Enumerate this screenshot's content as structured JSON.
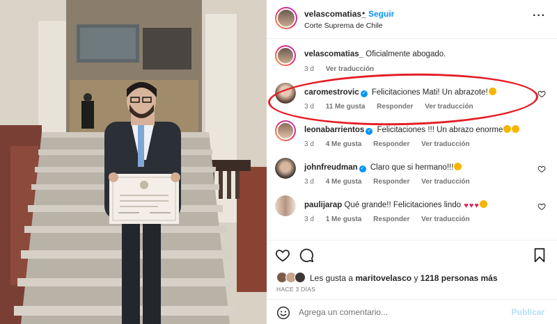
{
  "post": {
    "username": "velascomatias_",
    "separator": "•",
    "follow_label": "Seguir",
    "location": "Corte Suprema de Chile",
    "more_label": "···"
  },
  "comments": [
    {
      "username": "velascomatias_",
      "text": "Oficialmente abogado.",
      "time": "3 d",
      "likes": "",
      "reply": "",
      "translate": "Ver traducción",
      "verified": false
    },
    {
      "username": "caromestrovic",
      "text": "Felicitaciones Mati! Un abrazote!",
      "time": "3 d",
      "likes": "11 Me gusta",
      "reply": "Responder",
      "translate": "Ver traducción",
      "verified": true
    },
    {
      "username": "leonabarrientos",
      "text": "Felicitaciones !!! Un abrazo enorme",
      "time": "3 d",
      "likes": "4 Me gusta",
      "reply": "Responder",
      "translate": "Ver traducción",
      "verified": true
    },
    {
      "username": "johnfreudman",
      "text": "Claro que si hermano!!!",
      "time": "3 d",
      "likes": "4 Me gusta",
      "reply": "Responder",
      "translate": "Ver traducción",
      "verified": true
    },
    {
      "username": "paulijarap",
      "text": "Qué grande!! Felicitaciones lindo",
      "time": "3 d",
      "likes": "1 Me gusta",
      "reply": "Responder",
      "translate": "Ver traducción",
      "verified": true
    }
  ],
  "likes": {
    "prefix": "Les gusta a ",
    "user": "maritovelasco",
    "middle": " y ",
    "count": "1218 personas más"
  },
  "date_label": "HACE 3 DÍAS",
  "add_comment": {
    "placeholder": "Agrega un comentario...",
    "publish_label": "Publicar"
  },
  "colors": {
    "accent": "#0095f6",
    "highlight": "#e41e26",
    "muted": "#737373"
  },
  "icons": [
    "more-icon",
    "heart-icon",
    "comment-icon",
    "bookmark-icon",
    "smile-icon",
    "verified-icon"
  ]
}
